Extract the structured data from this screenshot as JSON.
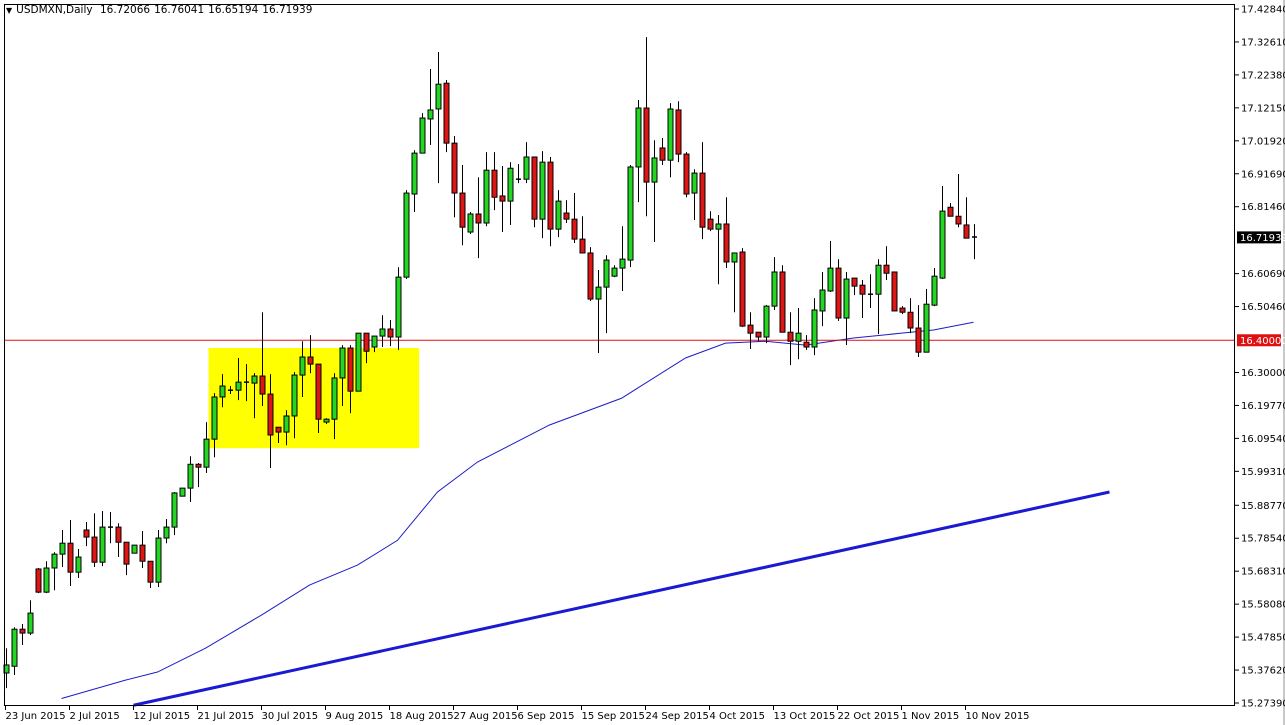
{
  "header": {
    "menu_icon": "triangle-down-icon",
    "symbol": "USDMXN,Daily",
    "open": "16.72066",
    "high": "16.76041",
    "low": "16.65194",
    "close": "16.71939"
  },
  "chart_data": {
    "type": "candlestick",
    "title": "USDMXN,Daily",
    "ylim": [
      15.2739,
      17.4284
    ],
    "grid": false,
    "colors": {
      "up": "#22d622",
      "down": "#dd1515",
      "ma": "#1c1cc8",
      "trendline": "#1a1ad2",
      "level": "#e01010",
      "zone": "#ffff00",
      "current_price_bg": "#000000"
    },
    "y_ticks": [
      "17.42840",
      "17.32610",
      "17.22380",
      "17.12150",
      "17.01920",
      "16.91690",
      "16.81460",
      "16.60690",
      "16.50460",
      "16.30000",
      "16.19770",
      "16.09540",
      "15.99310",
      "15.88770",
      "15.78540",
      "15.68310",
      "15.58080",
      "15.47850",
      "15.37620",
      "15.27390"
    ],
    "x_ticks": [
      {
        "index": 0,
        "label": "23 Jun 2015"
      },
      {
        "index": 8,
        "label": "2 Jul 2015"
      },
      {
        "index": 16,
        "label": "12 Jul 2015"
      },
      {
        "index": 24,
        "label": "21 Jul 2015"
      },
      {
        "index": 32,
        "label": "30 Jul 2015"
      },
      {
        "index": 40,
        "label": "9 Aug 2015"
      },
      {
        "index": 48,
        "label": "18 Aug 2015"
      },
      {
        "index": 56,
        "label": "27 Aug 2015"
      },
      {
        "index": 64,
        "label": "6 Sep 2015"
      },
      {
        "index": 72,
        "label": "15 Sep 2015"
      },
      {
        "index": 80,
        "label": "24 Sep 2015"
      },
      {
        "index": 88,
        "label": "4 Oct 2015"
      },
      {
        "index": 96,
        "label": "13 Oct 2015"
      },
      {
        "index": 104,
        "label": "22 Oct 2015"
      },
      {
        "index": 112,
        "label": "1 Nov 2015"
      },
      {
        "index": 120,
        "label": "10 Nov 2015"
      }
    ],
    "ohlc_fields": [
      "open",
      "high",
      "low",
      "close"
    ],
    "candles": [
      [
        15.367,
        15.444,
        15.32,
        15.392
      ],
      [
        15.388,
        15.509,
        15.361,
        15.503
      ],
      [
        15.503,
        15.519,
        15.454,
        15.491
      ],
      [
        15.491,
        15.593,
        15.485,
        15.553
      ],
      [
        15.69,
        15.693,
        15.615,
        15.618
      ],
      [
        15.618,
        15.714,
        15.615,
        15.693
      ],
      [
        15.693,
        15.742,
        15.624,
        15.736
      ],
      [
        15.736,
        15.811,
        15.696,
        15.77
      ],
      [
        15.77,
        15.842,
        15.637,
        15.68
      ],
      [
        15.68,
        15.752,
        15.662,
        15.727
      ],
      [
        15.811,
        15.836,
        15.761,
        15.789
      ],
      [
        15.789,
        15.863,
        15.696,
        15.711
      ],
      [
        15.711,
        15.87,
        15.699,
        15.82
      ],
      [
        15.82,
        15.867,
        15.77,
        15.82
      ],
      [
        15.82,
        15.832,
        15.727,
        15.773
      ],
      [
        15.773,
        15.773,
        15.671,
        15.705
      ],
      [
        15.739,
        15.764,
        15.739,
        15.764
      ],
      [
        15.764,
        15.808,
        15.693,
        15.714
      ],
      [
        15.714,
        15.714,
        15.631,
        15.649
      ],
      [
        15.649,
        15.811,
        15.634,
        15.786
      ],
      [
        15.786,
        15.845,
        15.77,
        15.82
      ],
      [
        15.82,
        15.929,
        15.795,
        15.926
      ],
      [
        15.916,
        15.941,
        15.916,
        15.941
      ],
      [
        15.941,
        16.04,
        15.898,
        16.015
      ],
      [
        16.015,
        16.019,
        15.944,
        16.006
      ],
      [
        16.006,
        16.146,
        15.988,
        16.093
      ],
      [
        16.093,
        16.236,
        16.037,
        16.224
      ],
      [
        16.224,
        16.295,
        16.192,
        16.258
      ],
      [
        16.245,
        16.258,
        16.233,
        16.245
      ],
      [
        16.245,
        16.345,
        16.214,
        16.27
      ],
      [
        16.27,
        16.326,
        16.211,
        16.27
      ],
      [
        16.267,
        16.298,
        16.158,
        16.289
      ],
      [
        16.289,
        16.487,
        16.196,
        16.233
      ],
      [
        16.233,
        16.295,
        16.003,
        16.106
      ],
      [
        16.13,
        16.13,
        16.081,
        16.115
      ],
      [
        16.115,
        16.183,
        16.074,
        16.165
      ],
      [
        16.165,
        16.301,
        16.096,
        16.292
      ],
      [
        16.292,
        16.397,
        16.224,
        16.348
      ],
      [
        16.348,
        16.416,
        16.298,
        16.326
      ],
      [
        16.326,
        16.326,
        16.112,
        16.155
      ],
      [
        16.146,
        16.158,
        16.14,
        16.155
      ],
      [
        16.155,
        16.298,
        16.093,
        16.283
      ],
      [
        16.283,
        16.385,
        16.196,
        16.376
      ],
      [
        16.376,
        16.385,
        16.174,
        16.242
      ],
      [
        16.242,
        16.422,
        16.242,
        16.422
      ],
      [
        16.422,
        16.422,
        16.329,
        16.366
      ],
      [
        16.379,
        16.413,
        16.363,
        16.413
      ],
      [
        16.413,
        16.478,
        16.379,
        16.435
      ],
      [
        16.435,
        16.463,
        16.382,
        16.41
      ],
      [
        16.41,
        16.627,
        16.37,
        16.596
      ],
      [
        16.596,
        16.866,
        16.59,
        16.857
      ],
      [
        16.854,
        16.99,
        16.798,
        16.981
      ],
      [
        16.981,
        17.105,
        16.981,
        17.09
      ],
      [
        17.087,
        17.242,
        17.006,
        17.115
      ],
      [
        17.118,
        17.295,
        16.888,
        17.195
      ],
      [
        17.198,
        17.208,
        16.984,
        17.012
      ],
      [
        17.012,
        17.034,
        16.782,
        16.857
      ],
      [
        16.857,
        16.944,
        16.695,
        16.751
      ],
      [
        16.736,
        16.798,
        16.73,
        16.792
      ],
      [
        16.792,
        16.906,
        16.655,
        16.764
      ],
      [
        16.764,
        16.984,
        16.754,
        16.928
      ],
      [
        16.928,
        16.984,
        16.804,
        16.844
      ],
      [
        16.848,
        16.941,
        16.736,
        16.832
      ],
      [
        16.832,
        16.953,
        16.758,
        16.934
      ],
      [
        16.897,
        16.947,
        16.888,
        16.9
      ],
      [
        16.9,
        17.015,
        16.888,
        16.969
      ],
      [
        16.969,
        16.969,
        16.751,
        16.776
      ],
      [
        16.776,
        16.987,
        16.717,
        16.953
      ],
      [
        16.953,
        16.969,
        16.692,
        16.745
      ],
      [
        16.745,
        16.866,
        16.72,
        16.832
      ],
      [
        16.795,
        16.835,
        16.764,
        16.776
      ],
      [
        16.776,
        16.857,
        16.702,
        16.714
      ],
      [
        16.714,
        16.785,
        16.671,
        16.671
      ],
      [
        16.671,
        16.689,
        16.522,
        16.528
      ],
      [
        16.528,
        16.618,
        16.36,
        16.565
      ],
      [
        16.565,
        16.664,
        16.422,
        16.649
      ],
      [
        16.599,
        16.633,
        16.596,
        16.624
      ],
      [
        16.624,
        16.754,
        16.553,
        16.652
      ],
      [
        16.649,
        16.944,
        16.627,
        16.938
      ],
      [
        16.938,
        17.146,
        16.829,
        17.121
      ],
      [
        17.121,
        17.341,
        16.785,
        16.891
      ],
      [
        16.891,
        17.021,
        16.705,
        16.966
      ],
      [
        16.997,
        17.028,
        16.944,
        16.959
      ],
      [
        16.959,
        17.136,
        16.906,
        17.118
      ],
      [
        17.115,
        17.142,
        16.953,
        16.978
      ],
      [
        16.978,
        16.984,
        16.844,
        16.854
      ],
      [
        16.857,
        16.931,
        16.773,
        16.919
      ],
      [
        16.919,
        17.015,
        16.714,
        16.751
      ],
      [
        16.776,
        16.801,
        16.739,
        16.745
      ],
      [
        16.745,
        16.789,
        16.574,
        16.761
      ],
      [
        16.761,
        16.844,
        16.624,
        16.643
      ],
      [
        16.643,
        16.671,
        16.487,
        16.671
      ],
      [
        16.674,
        16.686,
        16.441,
        16.444
      ],
      [
        16.447,
        16.487,
        16.373,
        16.422
      ],
      [
        16.425,
        16.425,
        16.397,
        16.41
      ],
      [
        16.41,
        16.509,
        16.391,
        16.506
      ],
      [
        16.506,
        16.658,
        16.494,
        16.612
      ],
      [
        16.612,
        16.633,
        16.425,
        16.425
      ],
      [
        16.425,
        16.487,
        16.323,
        16.397
      ],
      [
        16.397,
        16.5,
        16.341,
        16.422
      ],
      [
        16.394,
        16.416,
        16.37,
        16.379
      ],
      [
        16.379,
        16.531,
        16.354,
        16.494
      ],
      [
        16.491,
        16.612,
        16.444,
        16.556
      ],
      [
        16.553,
        16.708,
        16.55,
        16.624
      ],
      [
        16.624,
        16.652,
        16.46,
        16.469
      ],
      [
        16.469,
        16.612,
        16.385,
        16.59
      ],
      [
        16.593,
        16.593,
        16.54,
        16.568
      ],
      [
        16.571,
        16.587,
        16.469,
        16.543
      ],
      [
        16.543,
        16.605,
        16.5,
        16.543
      ],
      [
        16.543,
        16.652,
        16.419,
        16.633
      ],
      [
        16.633,
        16.692,
        16.587,
        16.608
      ],
      [
        16.612,
        16.612,
        16.491,
        16.491
      ],
      [
        16.5,
        16.506,
        16.481,
        16.487
      ],
      [
        16.487,
        16.531,
        16.422,
        16.438
      ],
      [
        16.438,
        16.509,
        16.348,
        16.363
      ],
      [
        16.363,
        16.559,
        16.363,
        16.512
      ],
      [
        16.509,
        16.624,
        16.506,
        16.599
      ],
      [
        16.593,
        16.879,
        16.59,
        16.801
      ],
      [
        16.813,
        16.826,
        16.785,
        16.785
      ],
      [
        16.785,
        16.916,
        16.751,
        16.761
      ],
      [
        16.758,
        16.844,
        16.717,
        16.717
      ],
      [
        16.72066,
        16.76041,
        16.65194,
        16.71939
      ]
    ],
    "moving_average": [
      [
        7,
        15.288
      ],
      [
        15,
        15.345
      ],
      [
        19,
        15.37
      ],
      [
        25,
        15.444
      ],
      [
        32,
        15.547
      ],
      [
        38,
        15.64
      ],
      [
        44,
        15.702
      ],
      [
        49,
        15.779
      ],
      [
        54,
        15.929
      ],
      [
        59,
        16.022
      ],
      [
        68,
        16.137
      ],
      [
        77,
        16.22
      ],
      [
        85,
        16.345
      ],
      [
        90,
        16.391
      ],
      [
        95,
        16.397
      ],
      [
        100,
        16.385
      ],
      [
        106,
        16.407
      ],
      [
        112,
        16.422
      ],
      [
        116,
        16.432
      ],
      [
        121,
        16.456
      ]
    ],
    "trendline": [
      [
        16,
        15.267
      ],
      [
        138,
        15.929
      ]
    ],
    "horizontal_level": {
      "price": 16.4,
      "label": "16.40000"
    },
    "zone": {
      "from_index": 26,
      "to_index": 51.7,
      "low": 16.065,
      "high": 16.376
    },
    "current_price": {
      "price": 16.71939,
      "label": "16.71939"
    }
  }
}
